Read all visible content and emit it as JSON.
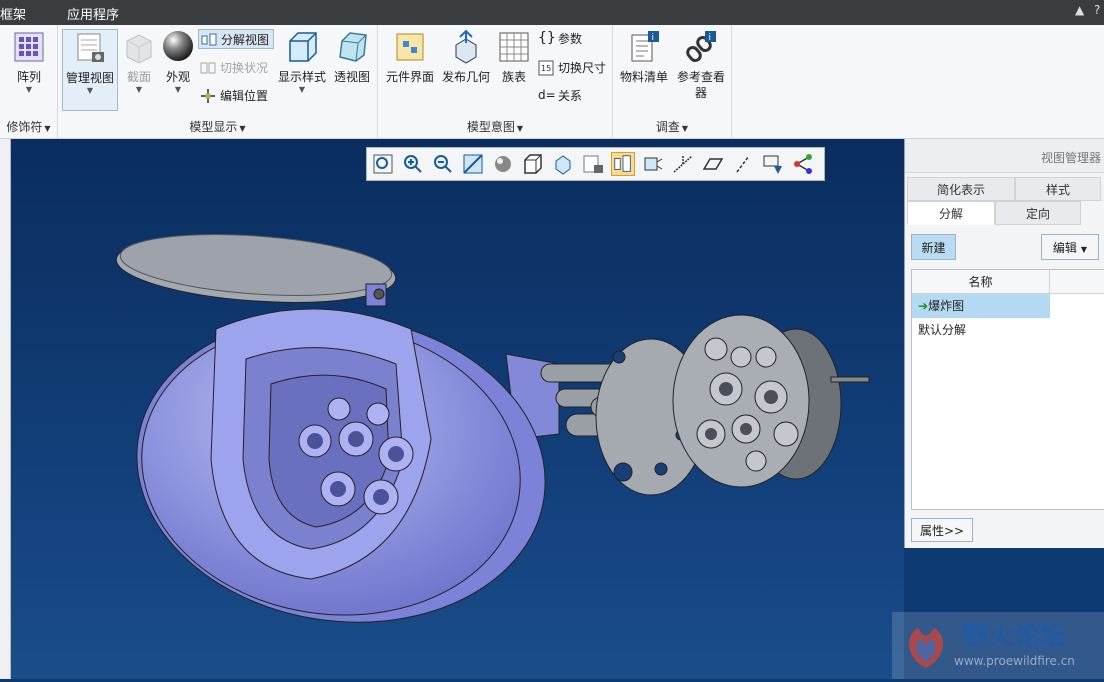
{
  "menu": {
    "left_tab": "框架",
    "tab_app": "应用程序"
  },
  "ribbon": {
    "g1": {
      "label": "修饰符",
      "array": "阵列"
    },
    "g2": {
      "label": "模型显示",
      "manage_view": "管理视图",
      "section": "截面",
      "appearance": "外观",
      "explode": "分解视图",
      "toggle_state": "切换状况",
      "edit_pos": "编辑位置",
      "display_style": "显示样式",
      "perspective": "透视图"
    },
    "g3": {
      "label": "模型意图",
      "comp_iface": "元件界面",
      "publish_geom": "发布几何",
      "family_table": "族表",
      "params": "参数",
      "switch_dim": "切换尺寸",
      "relations": "关系"
    },
    "g4": {
      "label": "调查",
      "bom": "物料清单",
      "ref_viewer_1": "参考查看",
      "ref_viewer_2": "器"
    }
  },
  "panel": {
    "title": "视图管理器",
    "tabs_row1": [
      "简化表示",
      "样式"
    ],
    "tabs_row2": [
      "分解",
      "定向"
    ],
    "new_button": "新建",
    "edit_button": "编辑",
    "col_name": "名称",
    "items": [
      "爆炸图",
      "默认分解"
    ],
    "props_button": "属性>>"
  },
  "watermark": {
    "cn": "野火论坛",
    "url": "www.proewildfire.cn"
  },
  "colors": {
    "viewport": "#0d3a73",
    "part": "#8f96e8",
    "selection": "#b4daf3"
  }
}
